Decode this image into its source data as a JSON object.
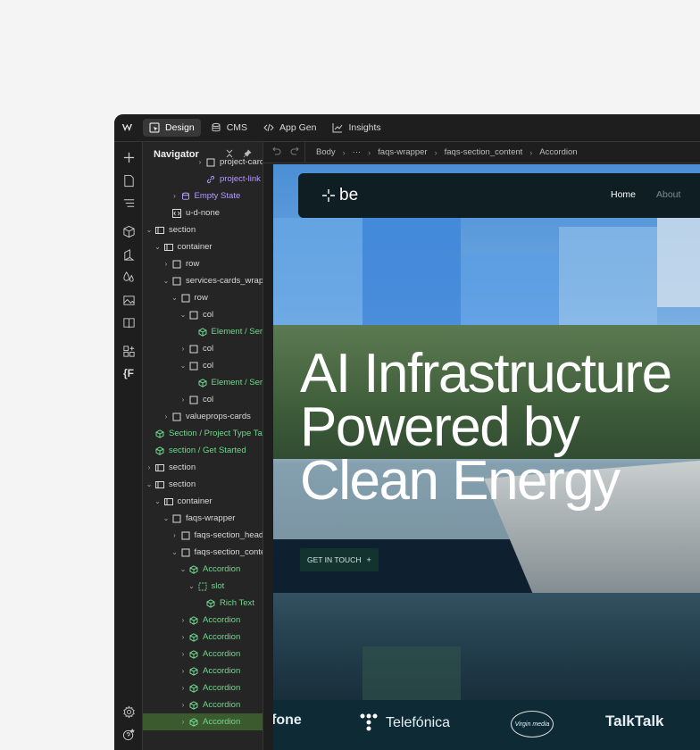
{
  "topbar": {
    "tabs": [
      {
        "label": "Design",
        "icon": "design-icon",
        "active": true
      },
      {
        "label": "CMS",
        "icon": "database-icon",
        "active": false
      },
      {
        "label": "App Gen",
        "icon": "code-icon",
        "active": false
      },
      {
        "label": "Insights",
        "icon": "chart-icon",
        "active": false
      }
    ]
  },
  "navigator": {
    "title": "Navigator",
    "rows": [
      {
        "label": "project-card",
        "indent": 6,
        "caret": ">",
        "icon": "box",
        "color": "default"
      },
      {
        "label": "project-link",
        "indent": 6,
        "caret": "",
        "icon": "link",
        "color": "purple"
      },
      {
        "label": "Empty State",
        "indent": 3,
        "caret": ">",
        "icon": "db",
        "color": "purple"
      },
      {
        "label": "u-d-none",
        "indent": 2,
        "caret": "",
        "icon": "embed",
        "color": "default"
      },
      {
        "label": "section",
        "indent": 0,
        "caret": "v",
        "icon": "section",
        "color": "default"
      },
      {
        "label": "container",
        "indent": 1,
        "caret": "v",
        "icon": "section",
        "color": "default"
      },
      {
        "label": "row",
        "indent": 2,
        "caret": ">",
        "icon": "box",
        "color": "default"
      },
      {
        "label": "services-cards_wrapper",
        "indent": 2,
        "caret": "v",
        "icon": "box",
        "color": "default"
      },
      {
        "label": "row",
        "indent": 3,
        "caret": "v",
        "icon": "box",
        "color": "default"
      },
      {
        "label": "col",
        "indent": 4,
        "caret": "v",
        "icon": "box",
        "color": "default"
      },
      {
        "label": "Element / Services",
        "indent": 5,
        "caret": "",
        "icon": "component",
        "color": "green"
      },
      {
        "label": "col",
        "indent": 4,
        "caret": ">",
        "icon": "box",
        "color": "default"
      },
      {
        "label": "col",
        "indent": 4,
        "caret": "v",
        "icon": "box",
        "color": "default"
      },
      {
        "label": "Element / Services",
        "indent": 5,
        "caret": "",
        "icon": "component",
        "color": "green"
      },
      {
        "label": "col",
        "indent": 4,
        "caret": ">",
        "icon": "box",
        "color": "default"
      },
      {
        "label": "valueprops-cards",
        "indent": 2,
        "caret": ">",
        "icon": "box",
        "color": "default"
      },
      {
        "label": "Section / Project Type Tabs",
        "indent": 0,
        "caret": "",
        "icon": "component",
        "color": "green"
      },
      {
        "label": "section / Get Started",
        "indent": 0,
        "caret": "",
        "icon": "component",
        "color": "green"
      },
      {
        "label": "section",
        "indent": 0,
        "caret": ">",
        "icon": "section",
        "color": "default"
      },
      {
        "label": "section",
        "indent": 0,
        "caret": "v",
        "icon": "section",
        "color": "default"
      },
      {
        "label": "container",
        "indent": 1,
        "caret": "v",
        "icon": "section",
        "color": "default"
      },
      {
        "label": "faqs-wrapper",
        "indent": 2,
        "caret": "v",
        "icon": "box",
        "color": "default"
      },
      {
        "label": "faqs-section_heading",
        "indent": 3,
        "caret": ">",
        "icon": "box",
        "color": "default"
      },
      {
        "label": "faqs-section_content",
        "indent": 3,
        "caret": "v",
        "icon": "box",
        "color": "default"
      },
      {
        "label": "Accordion",
        "indent": 4,
        "caret": "v",
        "icon": "component",
        "color": "green"
      },
      {
        "label": "slot",
        "indent": 5,
        "caret": "v",
        "icon": "slot",
        "color": "green"
      },
      {
        "label": "Rich Text",
        "indent": 6,
        "caret": "",
        "icon": "component",
        "color": "green"
      },
      {
        "label": "Accordion",
        "indent": 4,
        "caret": ">",
        "icon": "component",
        "color": "green"
      },
      {
        "label": "Accordion",
        "indent": 4,
        "caret": ">",
        "icon": "component",
        "color": "green"
      },
      {
        "label": "Accordion",
        "indent": 4,
        "caret": ">",
        "icon": "component",
        "color": "green"
      },
      {
        "label": "Accordion",
        "indent": 4,
        "caret": ">",
        "icon": "component",
        "color": "green"
      },
      {
        "label": "Accordion",
        "indent": 4,
        "caret": ">",
        "icon": "component",
        "color": "green"
      },
      {
        "label": "Accordion",
        "indent": 4,
        "caret": ">",
        "icon": "component",
        "color": "green"
      },
      {
        "label": "Accordion",
        "indent": 4,
        "caret": ">",
        "icon": "component",
        "color": "green",
        "selected": true
      }
    ]
  },
  "breadcrumb": {
    "items": [
      "Body",
      "···",
      "faqs-wrapper",
      "faqs-section_content",
      "Accordion"
    ]
  },
  "site": {
    "brand": "be",
    "nav": [
      "Home",
      "About"
    ],
    "hero": [
      "AI Infrastructure",
      "Powered by",
      "Clean Energy"
    ],
    "cta": "GET IN TOUCH",
    "logos": [
      "fone",
      "Telefónica",
      "Virgin media",
      "TalkTalk"
    ]
  },
  "colors": {
    "accent_green": "#6fd88c",
    "purple": "#b39dfc",
    "selected_row": "#3b5b2e"
  }
}
